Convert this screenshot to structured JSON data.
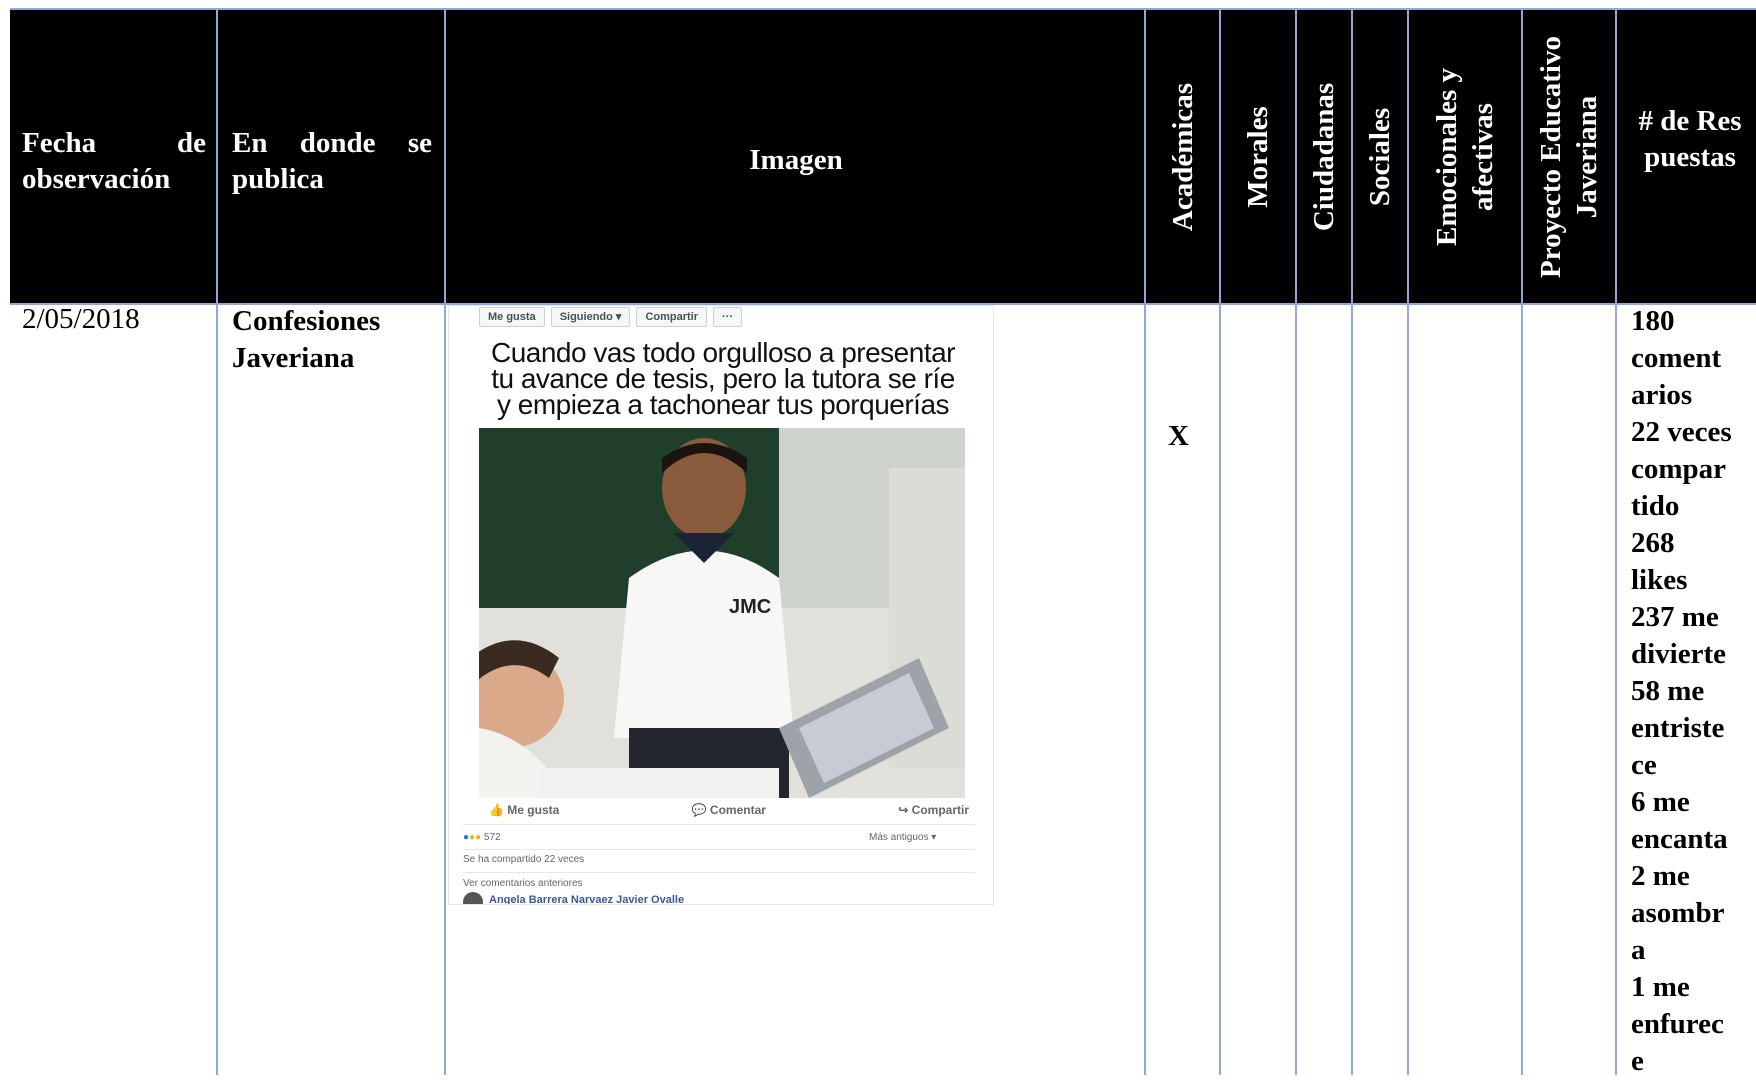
{
  "headers": {
    "fecha": "Fecha de observación",
    "donde": "En donde se publica",
    "imagen": "Imagen",
    "academicas": "Académicas",
    "morales": "Morales",
    "ciudadanas": "Ciudadanas",
    "sociales": "Sociales",
    "emocionales_1": "Emocionales y",
    "emocionales_2": "afectivas",
    "proyecto_1": "Proyecto Educativo",
    "proyecto_2": "Javeriana",
    "respuestas": "# de Respuestas"
  },
  "row": {
    "fecha": "2/05/2018",
    "donde": "Confesiones Javeriana",
    "academicas_mark": "X",
    "respuestas_lines": [
      "180",
      "coment",
      "arios",
      "22 veces",
      "compar",
      "tido",
      "268",
      "likes",
      "237 me",
      "divierte",
      "58 me",
      "entriste",
      "ce",
      "6 me",
      "encanta",
      "2 me",
      "asombr",
      "a",
      "1 me",
      "enfurec",
      "e"
    ]
  },
  "screenshot": {
    "toolbar": [
      "Me gusta",
      "Siguiendo ▾",
      "Compartir",
      "···"
    ],
    "caption": "Cuando vas todo orgulloso a presentar tu avance de tesis, pero la tutora se ríe y empieza a tachonear tus porquerías",
    "shirt_logo": "JMC",
    "actions": [
      "Me gusta",
      "Comentar",
      "Compartir"
    ],
    "reactions_count": "572",
    "sort_label": "Más antiguos ▾",
    "shared_text": "Se ha compartido 22 veces",
    "prev_comments": "Ver comentarios anteriores",
    "commenter": "Angela Barrera Narvaez Javier Ovalle"
  }
}
